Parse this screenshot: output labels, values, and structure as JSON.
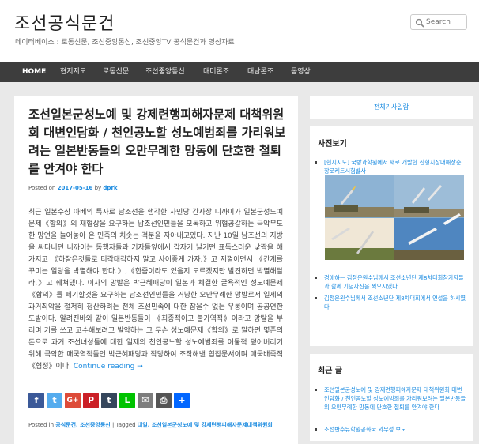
{
  "site": {
    "title": "조선공식문건",
    "description": "데이터베이스 : 로동신문, 조선중앙통신, 조선중앙TV 공식문건과 영상자료"
  },
  "search": {
    "placeholder": "Search"
  },
  "nav": {
    "items": [
      {
        "label": "HOME"
      },
      {
        "label": "현지지도"
      },
      {
        "label": "로동신문"
      },
      {
        "label": "조선중앙통신"
      },
      {
        "label": "대미론조"
      },
      {
        "label": "대남론조"
      },
      {
        "label": "동영상"
      }
    ]
  },
  "article": {
    "title": "조선일본군성노예 및 강제련행피해자문제 대책위원회 대변인담화 / 천인공노할 성노예범죄를 가리워보려는 일본반동들의 오만무례한 망동에 단호한 철퇴를 안겨야 한다",
    "meta": {
      "posted_on": "Posted on",
      "date": "2017-05-16",
      "by": "by",
      "author": "dprk"
    },
    "excerpt": "최근 일본수상 아베의 특사로 남조선을 행각한 자민당 간사장 니까이가 일본군성노예문제《합의》의 재협상을 요구하는 남조선인민들을 모독하고 위협공갈하는 극악무도한 망언을 늘어놓아 온 민족의 치솟는 격분을 자아내고있다. 지난 10일 남조선의 지방을 싸다니던 니까이는 동행자들과 기자들앞에서 갑자기 날기떤 표독스러운 낯짝을 해가지고 《하잘은것들로 티각태각하지 말고 사이좋게 가자.》고 지껄이면서 《간계를 꾸미는 일당을 박멸해야 한다.》,《한줌이라도 있을지 모르겠지만 발견하면 박멸해달라.》고 줴쳐댔다. 이자의 망발은 박근혜패당이 일본과 체결한 굴욕적인 성노예문제《합의》를 페기할것을 요구하는 남조선인민들을 거냥한 오만무례한 망발로서 일제의 과거죄악을 철저히 청산하려는 전체 조선민족에 대한 참을수 없는 우롱이며 공공연한 도발이다. 알려진바와 같이 일본반동들이 《최종적이고 불가역적》이라고 앙탈을 부리며 기를 쓰고 고수해보려고 발악하는 그 무슨 성노예문제《합의》로 말하면 몇푼의 돈으로 과거 조선녀성들에 대한 일제의 천인공노할 성노예범죄를 어물적 덮어버리기 위해 극악한 매국역적들인 박근혜패당과 작당하여 조작해낸 협잡문서이며 매국배족적《협정》이다.",
    "continue_label": "Continue reading →",
    "categories_label": "Posted in",
    "categories": "공식문건, 조선중앙통신",
    "tagged_label": "Tagged",
    "tags": "대일, 조선일본군성노예 및 강제련행피해자문제대책위원회"
  },
  "share": [
    {
      "icon": "facebook-icon",
      "glyph": "f",
      "color": "#3b5998"
    },
    {
      "icon": "twitter-icon",
      "glyph": "t",
      "color": "#55acee"
    },
    {
      "icon": "google-plus-icon",
      "glyph": "G+",
      "color": "#dd4b39"
    },
    {
      "icon": "pinterest-icon",
      "glyph": "P",
      "color": "#cb2027"
    },
    {
      "icon": "tumblr-icon",
      "glyph": "t",
      "color": "#35465c"
    },
    {
      "icon": "line-icon",
      "glyph": "L",
      "color": "#00c300"
    },
    {
      "icon": "email-icon",
      "glyph": "✉",
      "color": "#7d7d7d"
    },
    {
      "icon": "print-icon",
      "glyph": "⎙",
      "color": "#555555"
    },
    {
      "icon": "share-more-icon",
      "glyph": "+",
      "color": "#0166ff"
    }
  ],
  "sidebar": {
    "all_articles": "전체기사일람",
    "photo_heading": "사진보기",
    "photo_items": [
      {
        "text": "[현지지도] 국방과학원에서 새로 개발한 신형지상대해상순항로케트시험발사"
      },
      {
        "text": "경애하는 김정은원수님께서 조선소년단 제8차대회참가자들과 함께 기념사진을 찍으시였다"
      },
      {
        "text": "김정은원수님께서 조선소년단 제8차대회에서 연설을 하시였다"
      }
    ],
    "recent_heading": "최근 글",
    "recent_items": [
      {
        "text": "조선일본군성노예 및 강제련행피해자문제 대책위원회 대변인담화 / 천인공노할 성노예범죄를 가리워보려는 일본반동들의 오만무례한 망동에 단호한 철퇴를 안겨야 한다"
      },
      {
        "text": "조선반추뮤학원공화국 외무성 보도"
      }
    ]
  }
}
